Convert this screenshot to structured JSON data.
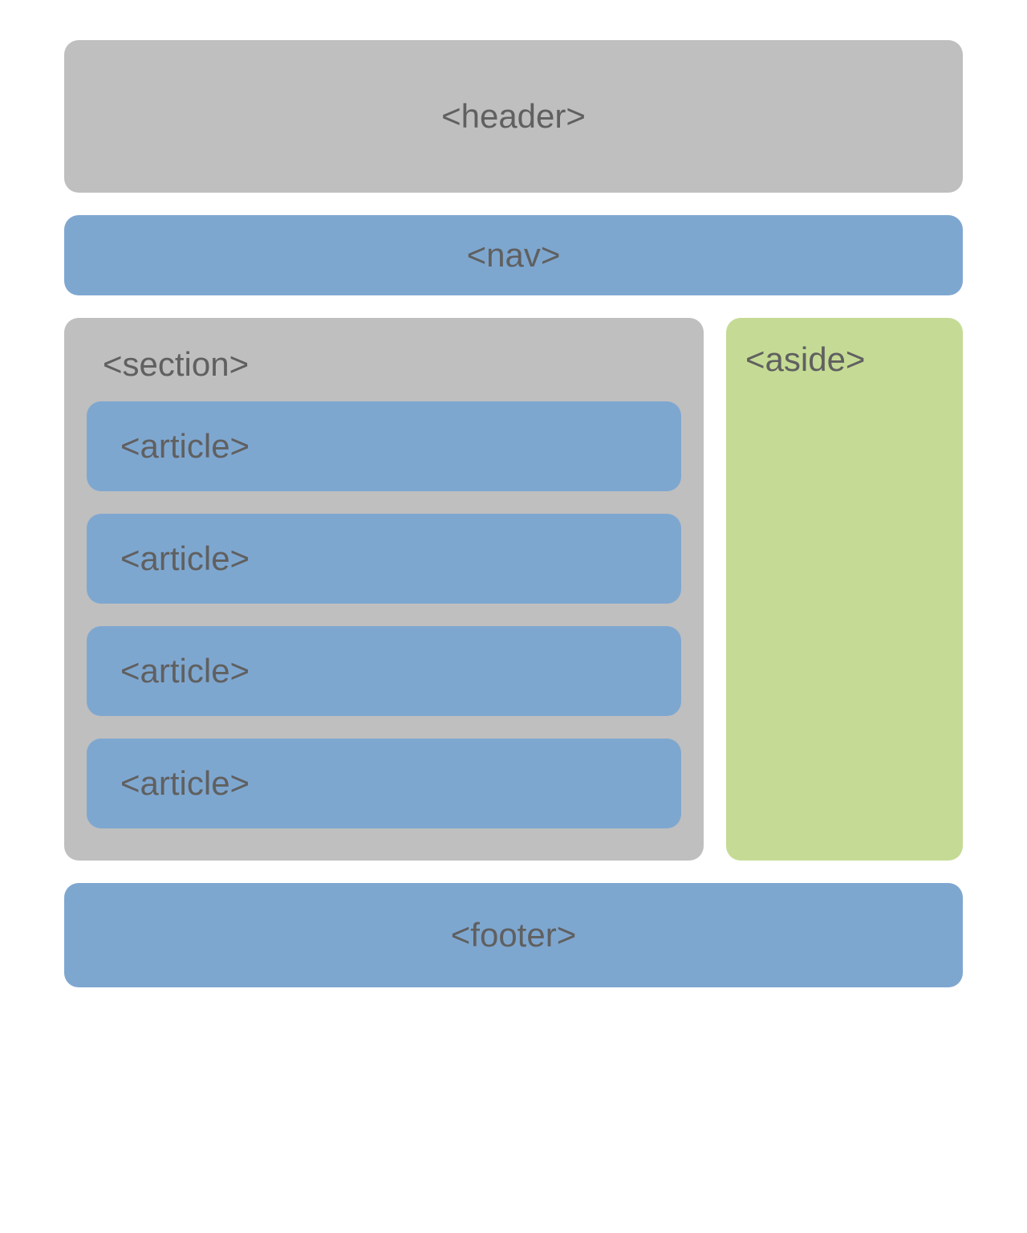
{
  "header": {
    "label": "<header>"
  },
  "nav": {
    "label": "<nav>"
  },
  "section": {
    "label": "<section>",
    "articles": [
      {
        "label": "<article>"
      },
      {
        "label": "<article>"
      },
      {
        "label": "<article>"
      },
      {
        "label": "<article>"
      }
    ]
  },
  "aside": {
    "label": "<aside>"
  },
  "footer": {
    "label": "<footer>"
  }
}
